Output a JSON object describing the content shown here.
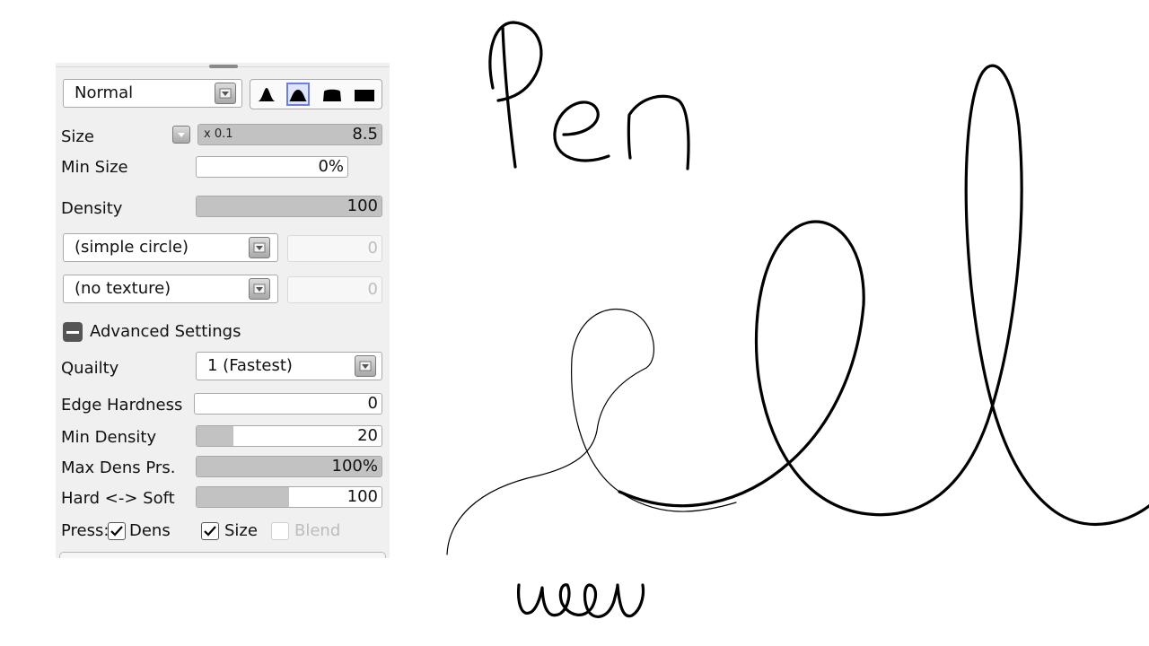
{
  "brush_panel": {
    "blend_mode": {
      "value": "Normal",
      "dropdown_icon": "chevron-down-icon"
    },
    "brush_shapes": [
      {
        "icon": "brush-shape-pointed-icon",
        "selected": false
      },
      {
        "icon": "brush-shape-round-icon",
        "selected": true
      },
      {
        "icon": "brush-shape-flat-icon",
        "selected": false
      },
      {
        "icon": "brush-shape-square-icon",
        "selected": false
      }
    ],
    "size": {
      "label": "Size",
      "multiplier": "x 0.1",
      "value": "8.5"
    },
    "min_size": {
      "label": "Min Size",
      "value": "0%"
    },
    "density": {
      "label": "Density",
      "value": "100",
      "fill_fraction": 1.0
    },
    "brush_tip": {
      "value": "(simple circle)",
      "strength": "0"
    },
    "texture": {
      "value": "(no texture)",
      "strength": "0"
    },
    "advanced": {
      "label": "Advanced Settings",
      "toggle_icon": "collapse-minus-icon"
    },
    "quality": {
      "label": "Quailty",
      "value": "1 (Fastest)"
    },
    "edge_hardness": {
      "label": "Edge Hardness",
      "value": "0",
      "fill_fraction": 0.0
    },
    "min_density": {
      "label": "Min Density",
      "value": "20",
      "fill_fraction": 0.2
    },
    "max_dens_prs": {
      "label": "Max Dens Prs.",
      "value": "100%",
      "fill_fraction": 1.0
    },
    "hard_soft": {
      "label": "Hard <-> Soft",
      "value": "100",
      "fill_fraction": 0.5
    },
    "pressure": {
      "label": "Press:",
      "dens": {
        "label": "Dens",
        "checked": true
      },
      "size": {
        "label": "Size",
        "checked": true
      },
      "blend": {
        "label": "Blend",
        "checked": false
      }
    }
  },
  "canvas": {
    "strokes": [
      "handwritten-pen-stroke",
      "thin-loop-stroke",
      "thick-double-loop-stroke",
      "handwritten-wow-stroke"
    ],
    "ink_color": "#000000"
  }
}
